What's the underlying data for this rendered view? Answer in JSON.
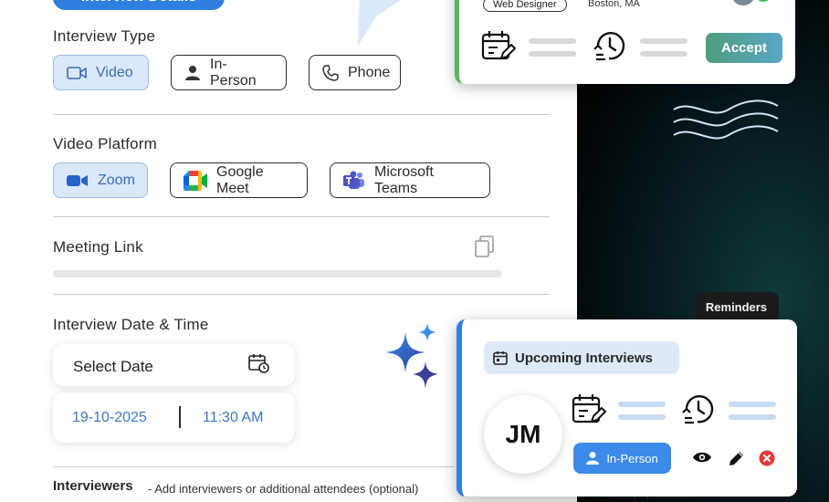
{
  "header": {
    "top_pill_label": "Interview Details"
  },
  "interview_type": {
    "title": "Interview Type",
    "options": [
      {
        "label": "Video",
        "icon": "video-camera-icon",
        "selected": true
      },
      {
        "label": "In-Person",
        "icon": "person-icon",
        "selected": false
      },
      {
        "label": "Phone",
        "icon": "phone-icon",
        "selected": false
      }
    ]
  },
  "video_platform": {
    "title": "Video Platform",
    "options": [
      {
        "label": "Zoom",
        "icon": "zoom-icon",
        "selected": true
      },
      {
        "label": "Google Meet",
        "icon": "google-meet-icon",
        "selected": false
      },
      {
        "label": "Microsoft Teams",
        "icon": "teams-icon",
        "selected": false
      }
    ]
  },
  "meeting_link": {
    "title": "Meeting Link",
    "copy_icon": "copy-icon"
  },
  "date_time": {
    "title": "Interview Date & Time",
    "select_date_label": "Select Date",
    "date_value": "19-10-2025",
    "time_value": "11:30 AM"
  },
  "interviewers": {
    "title": "Interviewers",
    "hint": "- Add interviewers or additional attendees (optional)"
  },
  "accept_card": {
    "role_tag": "Web Designer",
    "location": "Boston, MA",
    "accept_label": "Accept"
  },
  "reminders": {
    "label": "Reminders"
  },
  "upcoming": {
    "title": "Upcoming Interviews",
    "initials": "JM",
    "mode_label": "In-Person"
  },
  "colors": {
    "accent_blue": "#2f7fe0",
    "selected_bg": "#dbe8fa",
    "accept_green": "#58b45e"
  }
}
